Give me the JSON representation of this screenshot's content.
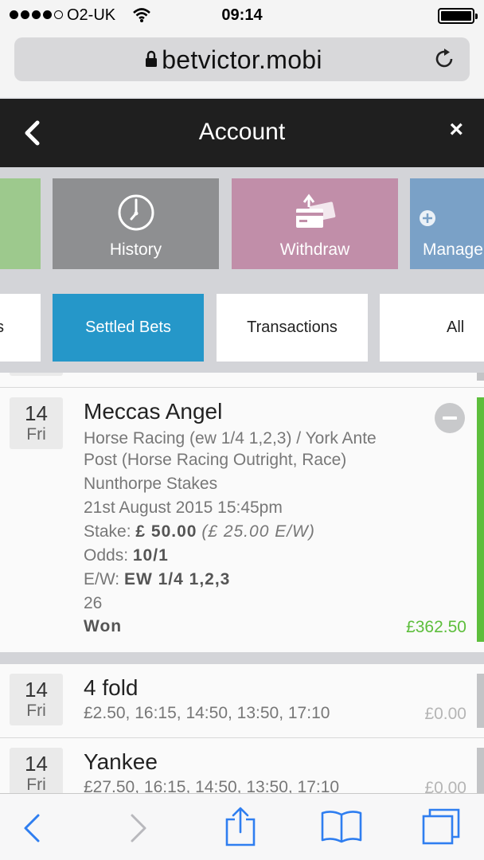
{
  "status_bar": {
    "carrier": "O2-UK",
    "time": "09:14"
  },
  "browser": {
    "url": "betvictor.mobi"
  },
  "header": {
    "title": "Account",
    "close_symbol": "×"
  },
  "tiles": [
    {
      "label": "",
      "icon": "tile-green",
      "color": "#9dc98d"
    },
    {
      "label": "History",
      "icon": "clock-icon",
      "color": "#8e8f91"
    },
    {
      "label": "Withdraw",
      "icon": "withdraw-card-icon",
      "color": "#c18ea9"
    },
    {
      "label": "Manage",
      "icon": "manage-icon",
      "color": "#7aa1c7"
    }
  ],
  "tabs": [
    {
      "label": "s",
      "active": false
    },
    {
      "label": "Settled Bets",
      "active": true
    },
    {
      "label": "Transactions",
      "active": false
    },
    {
      "label": "All",
      "active": false
    }
  ],
  "bets": [
    {
      "day": "14",
      "weekday": "Fri",
      "title": "Meccas Angel",
      "details": [
        "Horse Racing (ew 1/4 1,2,3) / York Ante",
        "Post (Horse Racing Outright, Race)",
        "Nunthorpe Stakes",
        "21st August 2015 15:45pm"
      ],
      "stake_label": "Stake:",
      "stake_value": "£ 50.00",
      "stake_ew": "(£ 25.00 E/W)",
      "odds_label": "Odds:",
      "odds_value": "10/1",
      "ew_label": "E/W:",
      "ew_value": "EW 1/4 1,2,3",
      "extra": "26",
      "result": "Won",
      "return": "£362.50",
      "status_color": "#5dbe3c"
    },
    {
      "day": "14",
      "weekday": "Fri",
      "title": "4 fold",
      "details": [
        "£2.50, 16:15, 14:50, 13:50, 17:10"
      ],
      "return": "£0.00",
      "status_color": "#c3c4c6"
    },
    {
      "day": "14",
      "weekday": "Fri",
      "title": "Yankee",
      "details": [
        "£27.50, 16:15, 14:50, 13:50, 17:10"
      ],
      "return": "£0.00",
      "status_color": "#c3c4c6"
    }
  ],
  "colors": {
    "accent": "#2597c9",
    "win": "#5dbe3c",
    "ios_blue": "#2f7ef0"
  }
}
